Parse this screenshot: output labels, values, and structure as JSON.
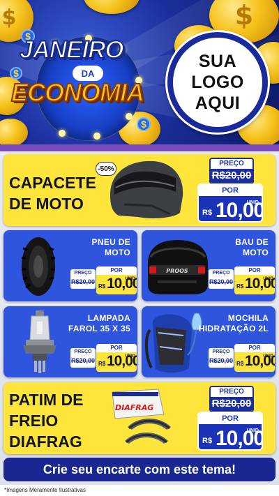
{
  "header": {
    "title_line1": "JANEIRO",
    "title_line2": "DA",
    "title_line3": "ECONOMIA",
    "logo_lines": [
      "SUA",
      "LOGO",
      "AQUI"
    ],
    "coin_symbol": "$"
  },
  "featured": [
    {
      "name_lines": [
        "CAPACETE",
        "DE MOTO"
      ],
      "discount": "-50%",
      "preco_label": "PREÇO",
      "old_price": "R$20,00",
      "por_label": "POR",
      "currency": "R$",
      "price": "10,00",
      "unit": "UNID",
      "icon": "motorcycle-helmet-icon"
    },
    {
      "name_lines": [
        "PATIM DE",
        "FREIO",
        "DIAFRAG"
      ],
      "preco_label": "PREÇO",
      "old_price": "R$20,00",
      "por_label": "POR",
      "currency": "R$",
      "price": "10,00",
      "unit": "UNID",
      "brand_on_box": "DIAFRAG",
      "icon": "brake-shoe-icon"
    }
  ],
  "products": [
    {
      "name_lines": [
        "PNEU DE",
        "MOTO"
      ],
      "preco_label": "PREÇO",
      "old_price": "R$20,00",
      "por_label": "POR",
      "currency": "R$",
      "price": "10,00",
      "unit": "UNID",
      "icon": "tire-icon"
    },
    {
      "name_lines": [
        "BAU DE",
        "MOTO"
      ],
      "preco_label": "PREÇO",
      "old_price": "R$20,00",
      "por_label": "POR",
      "currency": "R$",
      "price": "10,00",
      "unit": "UNID",
      "brand_on_box": "PROOS",
      "icon": "top-case-icon"
    },
    {
      "name_lines": [
        "LAMPADA",
        "FAROL 35 X 35"
      ],
      "preco_label": "PREÇO",
      "old_price": "R$20,00",
      "por_label": "POR",
      "currency": "R$",
      "price": "10,00",
      "unit": "UNID",
      "icon": "headlight-bulb-icon"
    },
    {
      "name_lines": [
        "MOCHILA",
        "HIDRATAÇÃO 2L"
      ],
      "preco_label": "PREÇO",
      "old_price": "R$20,00",
      "por_label": "POR",
      "currency": "R$",
      "price": "10,00",
      "unit": "UNID",
      "icon": "hydration-backpack-icon"
    }
  ],
  "cta": "Crie seu encarte com este tema!",
  "footer_note": "*Imagens Meramente Ilustrativas",
  "colors": {
    "brand_blue": "#2f55de",
    "dark_blue": "#1a2792",
    "yellow": "#fde53b",
    "header_bg": "#1b2f9c"
  }
}
